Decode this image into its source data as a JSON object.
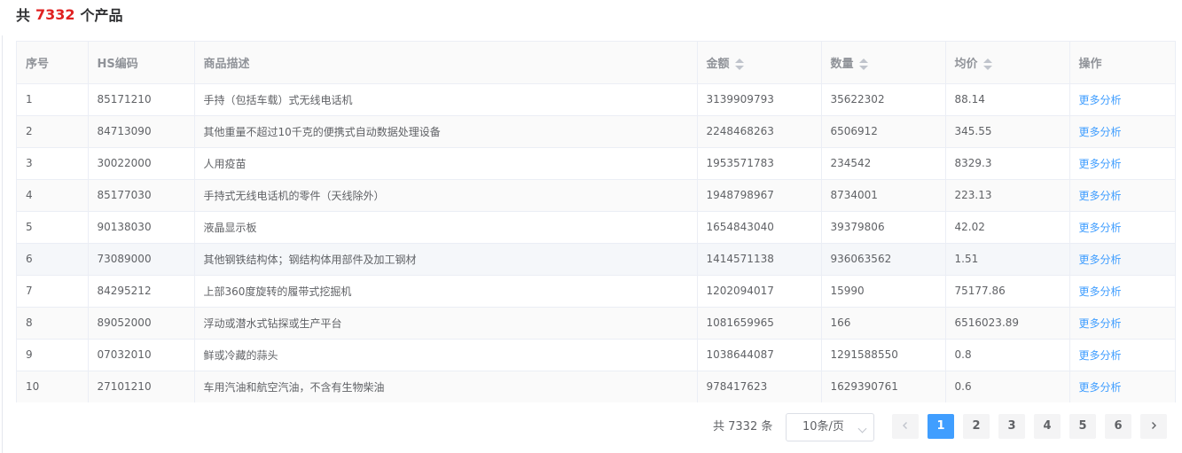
{
  "heading": {
    "prefix": "共",
    "count": "7332",
    "suffix": "个产品"
  },
  "table": {
    "headers": {
      "index": "序号",
      "hs_code": "HS编码",
      "description": "商品描述",
      "amount": "金额",
      "quantity": "数量",
      "avg_price": "均价",
      "action": "操作"
    },
    "rows": [
      {
        "index": "1",
        "hs_code": "85171210",
        "description": "手持（包括车载）式无线电话机",
        "amount": "3139909793",
        "quantity": "35622302",
        "avg_price": "88.14",
        "action": "更多分析"
      },
      {
        "index": "2",
        "hs_code": "84713090",
        "description": "其他重量不超过10千克的便携式自动数据处理设备",
        "amount": "2248468263",
        "quantity": "6506912",
        "avg_price": "345.55",
        "action": "更多分析"
      },
      {
        "index": "3",
        "hs_code": "30022000",
        "description": "人用疫苗",
        "amount": "1953571783",
        "quantity": "234542",
        "avg_price": "8329.3",
        "action": "更多分析"
      },
      {
        "index": "4",
        "hs_code": "85177030",
        "description": "手持式无线电话机的零件（天线除外）",
        "amount": "1948798967",
        "quantity": "8734001",
        "avg_price": "223.13",
        "action": "更多分析"
      },
      {
        "index": "5",
        "hs_code": "90138030",
        "description": "液晶显示板",
        "amount": "1654843040",
        "quantity": "39379806",
        "avg_price": "42.02",
        "action": "更多分析"
      },
      {
        "index": "6",
        "hs_code": "73089000",
        "description": "其他钢铁结构体；钢结构体用部件及加工钢材",
        "amount": "1414571138",
        "quantity": "936063562",
        "avg_price": "1.51",
        "action": "更多分析"
      },
      {
        "index": "7",
        "hs_code": "84295212",
        "description": "上部360度旋转的履带式挖掘机",
        "amount": "1202094017",
        "quantity": "15990",
        "avg_price": "75177.86",
        "action": "更多分析"
      },
      {
        "index": "8",
        "hs_code": "89052000",
        "description": "浮动或潜水式钻探或生产平台",
        "amount": "1081659965",
        "quantity": "166",
        "avg_price": "6516023.89",
        "action": "更多分析"
      },
      {
        "index": "9",
        "hs_code": "07032010",
        "description": "鲜或冷藏的蒜头",
        "amount": "1038644087",
        "quantity": "1291588550",
        "avg_price": "0.8",
        "action": "更多分析"
      },
      {
        "index": "10",
        "hs_code": "27101210",
        "description": "车用汽油和航空汽油，不含有生物柴油",
        "amount": "978417623",
        "quantity": "1629390761",
        "avg_price": "0.6",
        "action": "更多分析"
      }
    ]
  },
  "pagination": {
    "total_text": "共 7332 条",
    "page_size": "10条/页",
    "prev_icon": "chevron-left-icon",
    "next_icon": "chevron-right-icon",
    "pages": [
      "1",
      "2",
      "3",
      "4",
      "5",
      "6"
    ],
    "current_page": "1"
  },
  "colors": {
    "accent": "#409eff",
    "highlight": "#e02020"
  }
}
